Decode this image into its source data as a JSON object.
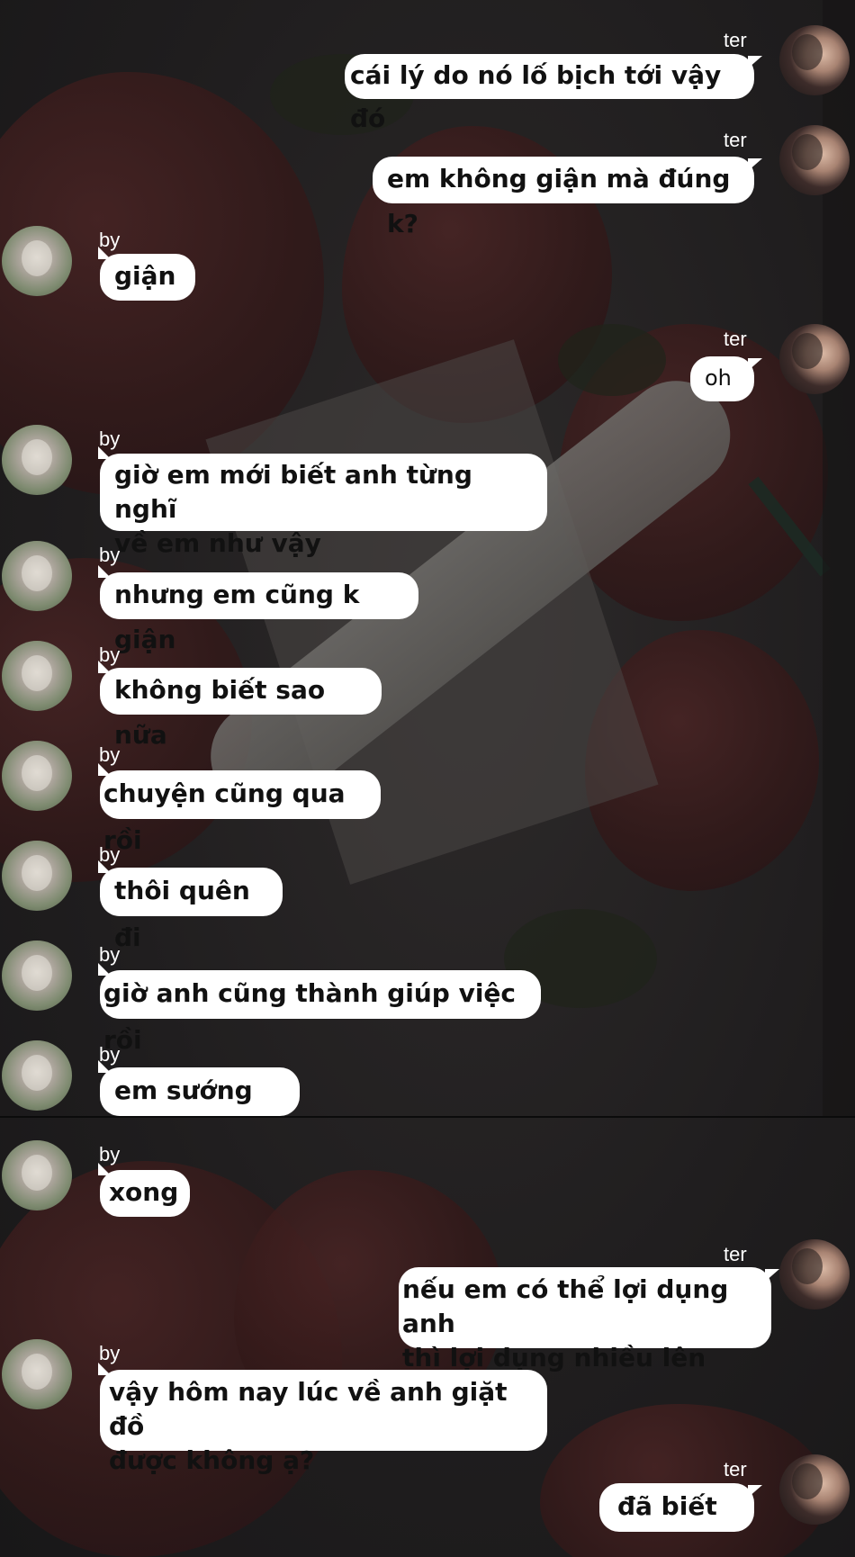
{
  "chat": {
    "messages": [
      {
        "sender": "ter",
        "text": "cái lý do nó lố bịch tới vậy đó"
      },
      {
        "sender": "ter",
        "text": "em không giận mà đúng k?"
      },
      {
        "sender": "by",
        "text": "giận"
      },
      {
        "sender": "ter",
        "text": "oh"
      },
      {
        "sender": "by",
        "text": "giờ em mới biết anh từng nghĩ\nvề em như vậy"
      },
      {
        "sender": "by",
        "text": "nhưng em cũng k giận"
      },
      {
        "sender": "by",
        "text": "không biết sao nữa"
      },
      {
        "sender": "by",
        "text": "chuyện cũng qua rồi"
      },
      {
        "sender": "by",
        "text": "thôi quên đi"
      },
      {
        "sender": "by",
        "text": "giờ anh cũng thành giúp việc rồi"
      },
      {
        "sender": "by",
        "text": "em sướng"
      },
      {
        "sender": "by",
        "text": "xong"
      },
      {
        "sender": "ter",
        "text": "nếu em có thể lợi dụng anh\nthì lợi dụng nhiều lên"
      },
      {
        "sender": "by",
        "text": "vậy hôm nay lúc về anh giặt đồ\nđược không ạ?"
      },
      {
        "sender": "ter",
        "text": "đã biết"
      }
    ]
  }
}
